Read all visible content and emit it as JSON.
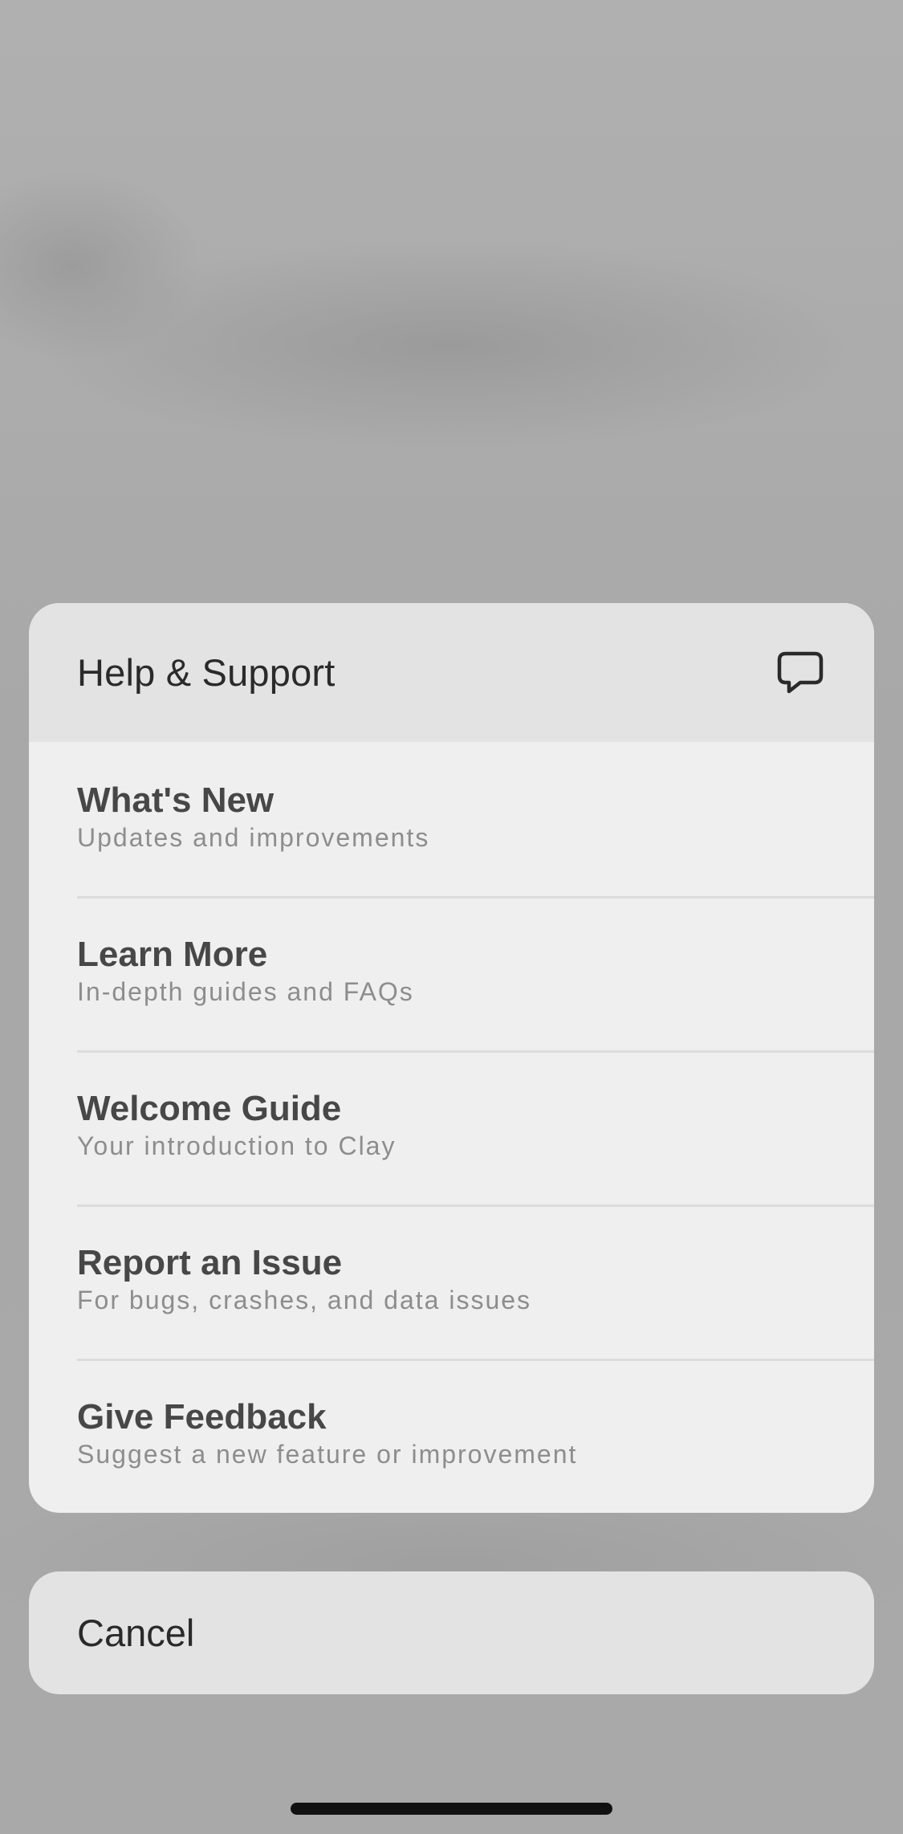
{
  "sheet": {
    "title": "Help & Support",
    "header_icon": "chat-bubble-icon",
    "items": [
      {
        "title": "What's New",
        "subtitle": "Updates and improvements"
      },
      {
        "title": "Learn More",
        "subtitle": "In-depth guides and FAQs"
      },
      {
        "title": "Welcome Guide",
        "subtitle": "Your introduction to Clay"
      },
      {
        "title": "Report an Issue",
        "subtitle": "For bugs, crashes, and data issues"
      },
      {
        "title": "Give Feedback",
        "subtitle": "Suggest a new feature or improvement"
      }
    ]
  },
  "cancel": {
    "label": "Cancel"
  },
  "colors": {
    "sheet_background": "#efefef",
    "header_background": "#e3e3e3",
    "title_text": "#2a2a2a",
    "item_title": "#474747",
    "item_subtitle": "#8d8d8d",
    "separator": "#dcdcdc"
  }
}
